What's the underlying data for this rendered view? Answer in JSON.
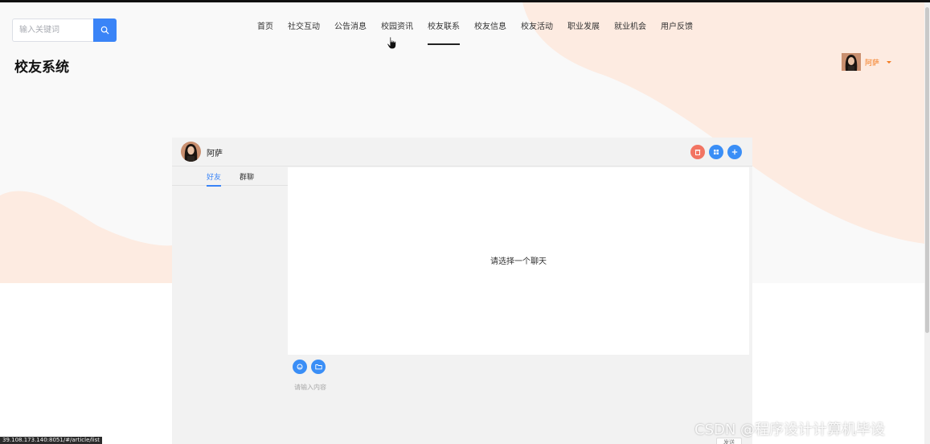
{
  "colors": {
    "accent": "#3a84f7",
    "user_name": "#f47b1f",
    "blob": "#fdebe1",
    "danger_button": "#f27462"
  },
  "search": {
    "placeholder": "输入关键词",
    "icon": "search-icon"
  },
  "nav": {
    "items": [
      {
        "label": "首页"
      },
      {
        "label": "社交互动"
      },
      {
        "label": "公告消息"
      },
      {
        "label": "校园资讯"
      },
      {
        "label": "校友联系",
        "active": true
      },
      {
        "label": "校友信息"
      },
      {
        "label": "校友活动"
      },
      {
        "label": "职业发展"
      },
      {
        "label": "就业机会"
      },
      {
        "label": "用户反馈"
      }
    ]
  },
  "site": {
    "title": "校友系统"
  },
  "user": {
    "name": "阿萨",
    "menu_icon": "caret-down-icon"
  },
  "chat": {
    "contact_name": "阿萨",
    "header_buttons": [
      "delete-icon",
      "grid-icon",
      "plus-icon"
    ],
    "tabs": [
      {
        "label": "好友",
        "active": true
      },
      {
        "label": "群聊",
        "active": false
      }
    ],
    "empty_text": "请选择一个聊天",
    "toolbar_icons": [
      "emoji-icon",
      "folder-icon"
    ],
    "input_placeholder": "请输入内容",
    "send_label": "发送"
  },
  "watermark": "CSDN @程序设计计算机毕设",
  "status_url": "39.108.173.140:8051/#/article/list"
}
